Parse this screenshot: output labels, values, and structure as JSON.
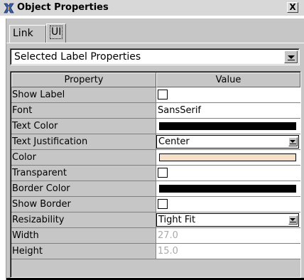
{
  "window": {
    "title": "Object Properties",
    "close_label": "X",
    "colors": {
      "title_bg": "#d8d8d8",
      "panel_bg": "#c6c6c6"
    }
  },
  "tabs": [
    {
      "label": "Link",
      "selected": false
    },
    {
      "label": "UI",
      "selected": true
    }
  ],
  "selector": {
    "value": "Selected Label Properties"
  },
  "table": {
    "headers": {
      "property": "Property",
      "value": "Value"
    },
    "rows": [
      {
        "name": "Show Label",
        "type": "checkbox",
        "checked": false
      },
      {
        "name": "Font",
        "type": "text",
        "value": "SansSerif"
      },
      {
        "name": "Text Color",
        "type": "color",
        "color": "#000000"
      },
      {
        "name": "Text Justification",
        "type": "combo",
        "value": "Center"
      },
      {
        "name": "Color",
        "type": "color",
        "color": "#f8e0c8"
      },
      {
        "name": "Transparent",
        "type": "checkbox",
        "checked": false
      },
      {
        "name": "Border Color",
        "type": "color",
        "color": "#000000"
      },
      {
        "name": "Show Border",
        "type": "checkbox",
        "checked": false
      },
      {
        "name": "Resizability",
        "type": "combo",
        "value": "Tight Fit"
      },
      {
        "name": "Width",
        "type": "disabled",
        "value": "27.0"
      },
      {
        "name": "Height",
        "type": "disabled",
        "value": "15.0"
      }
    ]
  },
  "icons": {
    "title": "tool-icon"
  }
}
